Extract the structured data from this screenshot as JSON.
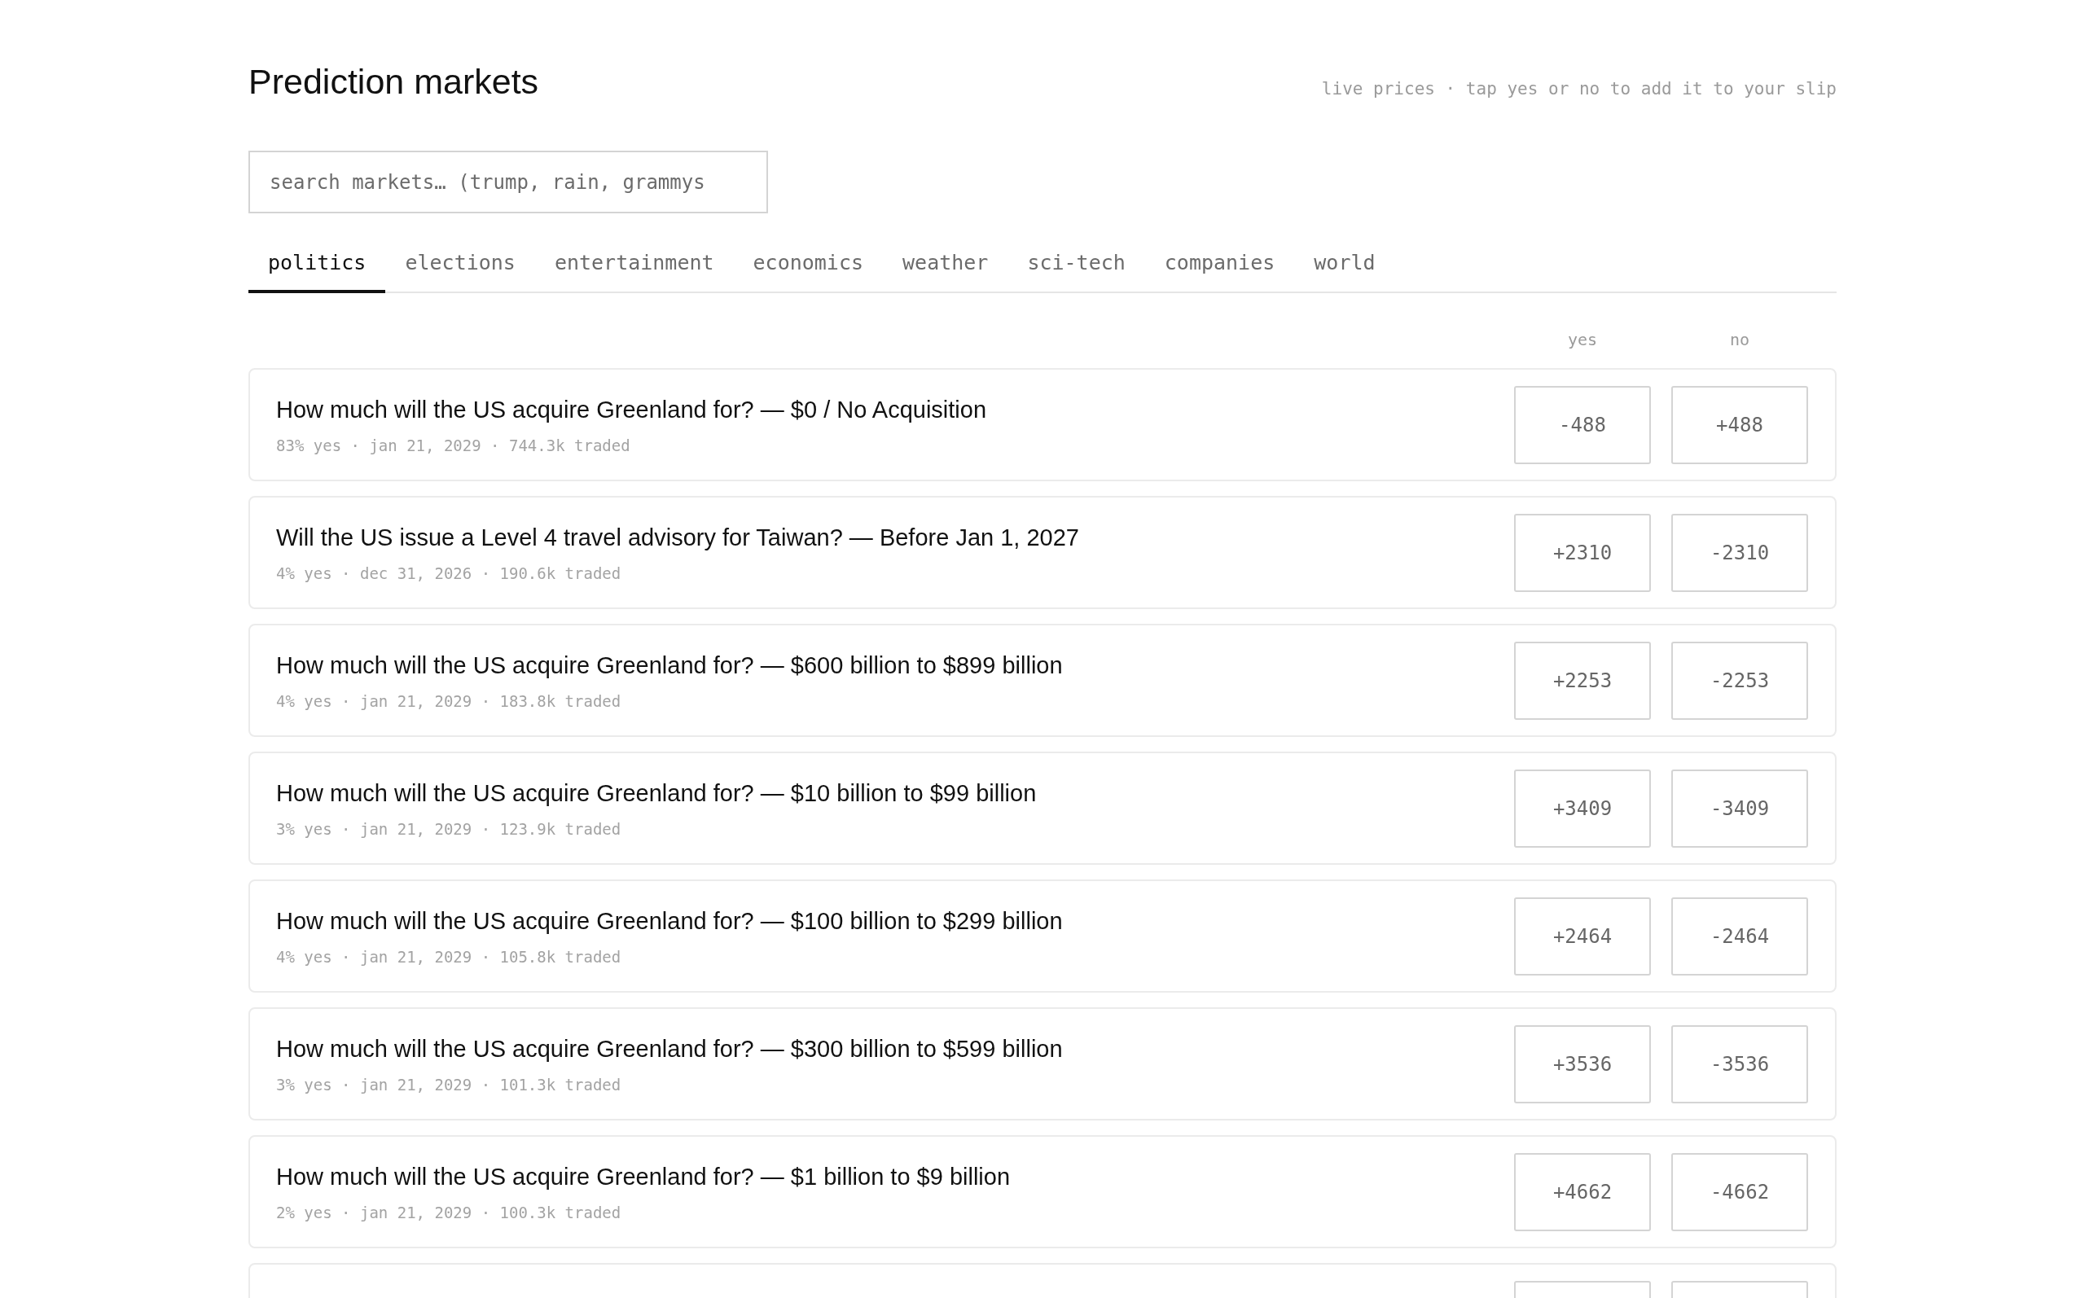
{
  "header": {
    "title": "Prediction markets",
    "hint": "live prices · tap yes or no to add it to your slip"
  },
  "search": {
    "placeholder": "search markets… (trump, rain, grammys"
  },
  "tabs": [
    {
      "label": "politics",
      "selected": true
    },
    {
      "label": "elections",
      "selected": false
    },
    {
      "label": "entertainment",
      "selected": false
    },
    {
      "label": "economics",
      "selected": false
    },
    {
      "label": "weather",
      "selected": false
    },
    {
      "label": "sci-tech",
      "selected": false
    },
    {
      "label": "companies",
      "selected": false
    },
    {
      "label": "world",
      "selected": false
    }
  ],
  "columns": {
    "yes": "yes",
    "no": "no"
  },
  "markets": [
    {
      "title": "How much will the US acquire Greenland for? — $0 / No Acquisition",
      "meta": "83% yes · jan 21, 2029 · 744.3k traded",
      "yes": "-488",
      "no": "+488"
    },
    {
      "title": "Will the US issue a Level 4 travel advisory for Taiwan? — Before Jan 1, 2027",
      "meta": "4% yes · dec 31, 2026 · 190.6k traded",
      "yes": "+2310",
      "no": "-2310"
    },
    {
      "title": "How much will the US acquire Greenland for? — $600 billion to $899 billion",
      "meta": "4% yes · jan 21, 2029 · 183.8k traded",
      "yes": "+2253",
      "no": "-2253"
    },
    {
      "title": "How much will the US acquire Greenland for? — $10 billion to $99 billion",
      "meta": "3% yes · jan 21, 2029 · 123.9k traded",
      "yes": "+3409",
      "no": "-3409"
    },
    {
      "title": "How much will the US acquire Greenland for? — $100 billion to $299 billion",
      "meta": "4% yes · jan 21, 2029 · 105.8k traded",
      "yes": "+2464",
      "no": "-2464"
    },
    {
      "title": "How much will the US acquire Greenland for? — $300 billion to $599 billion",
      "meta": "3% yes · jan 21, 2029 · 101.3k traded",
      "yes": "+3536",
      "no": "-3536"
    },
    {
      "title": "How much will the US acquire Greenland for? — $1 billion to $9 billion",
      "meta": "2% yes · jan 21, 2029 · 100.3k traded",
      "yes": "+4662",
      "no": "-4662"
    }
  ]
}
